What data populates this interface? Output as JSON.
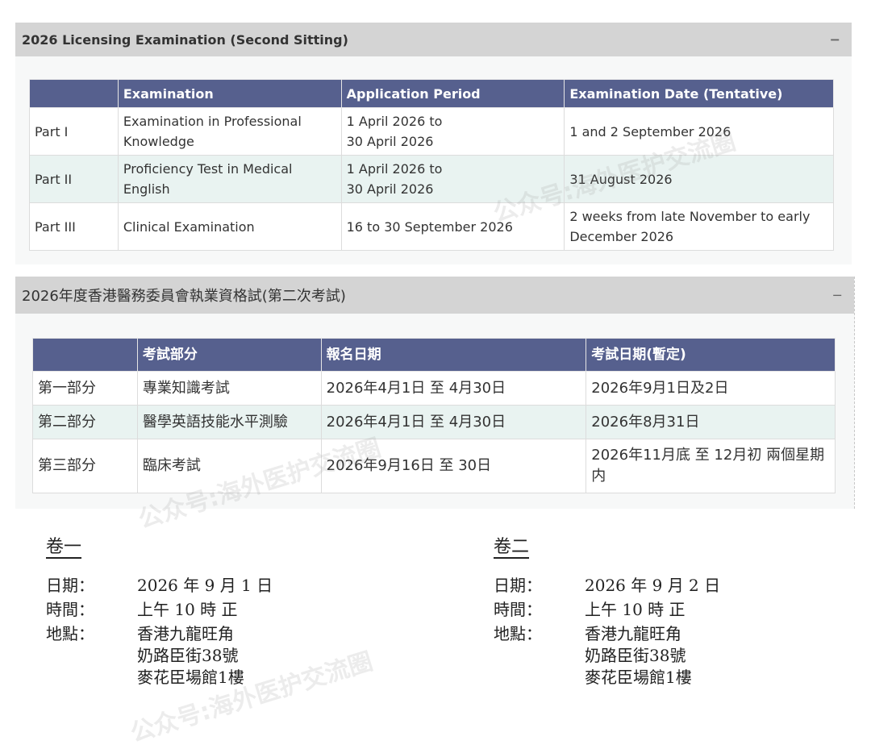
{
  "en_panel": {
    "title": "2026 Licensing Examination (Second Sitting)",
    "toggle": "−",
    "headers": [
      "",
      "Examination",
      "Application Period",
      "Examination Date (Tentative)"
    ],
    "rows": [
      [
        "Part I",
        "Examination in Professional Knowledge",
        "1 April 2026 to\n30 April 2026",
        "1 and 2 September 2026"
      ],
      [
        "Part II",
        "Proficiency Test in Medical English",
        "1 April 2026 to\n30 April 2026",
        "31 August 2026"
      ],
      [
        "Part III",
        "Clinical Examination",
        "16 to 30 September 2026",
        "2 weeks from late November to early December 2026"
      ]
    ]
  },
  "zh_panel": {
    "title": "2026年度香港醫務委員會執業資格試(第二次考試)",
    "toggle": "−",
    "headers": [
      "",
      "考試部分",
      "報名日期",
      "考試日期(暫定)"
    ],
    "rows": [
      [
        "第一部分",
        "專業知識考試",
        "2026年4月1日 至 4月30日",
        "2026年9月1日及2日"
      ],
      [
        "第二部分",
        "醫學英語技能水平測驗",
        "2026年4月1日 至 4月30日",
        "2026年8月31日"
      ],
      [
        "第三部分",
        "臨床考試",
        "2026年9月16日 至 30日",
        "2026年11月底 至 12月初 兩個星期内"
      ]
    ]
  },
  "volumes": [
    {
      "title": "卷一",
      "date_label": "日期：",
      "date": "2026 年 9 月 1 日",
      "time_label": "時間：",
      "time": "上午 10 時 正",
      "venue_label": "地點：",
      "venue": [
        "香港九龍旺角",
        "奶路臣街38號",
        "麥花臣場館1樓"
      ]
    },
    {
      "title": "卷二",
      "date_label": "日期：",
      "date": "2026 年 9 月 2 日",
      "time_label": "時間：",
      "time": "上午 10 時 正",
      "venue_label": "地點：",
      "venue": [
        "香港九龍旺角",
        "奶路臣街38號",
        "麥花臣場館1樓"
      ]
    }
  ],
  "watermark": "公众号:海外医护交流圈"
}
